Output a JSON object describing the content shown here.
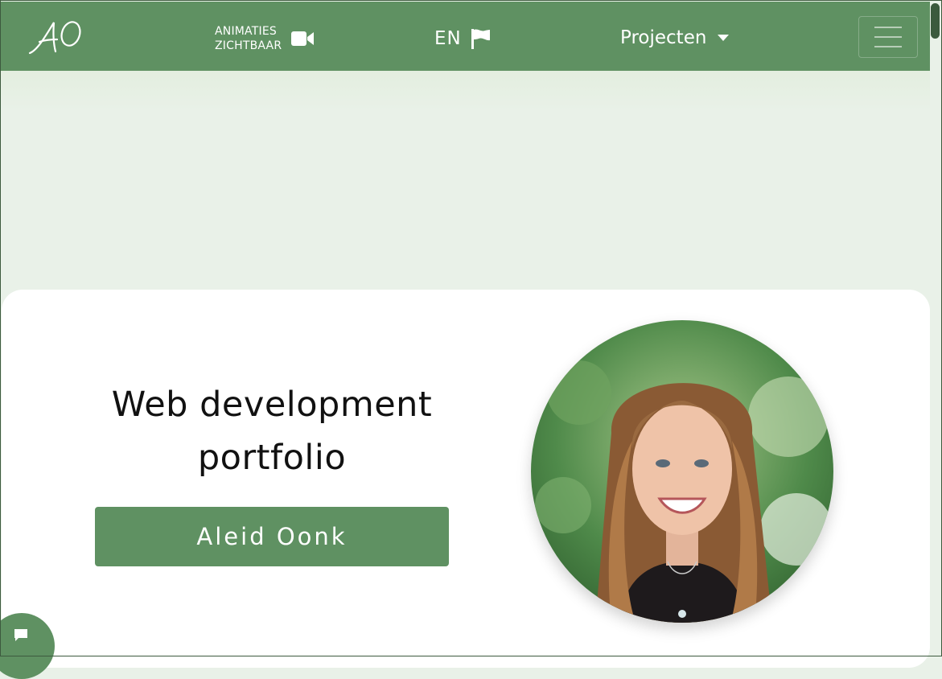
{
  "header": {
    "logo_text": "AO",
    "animations_toggle": {
      "line1": "ANIMATIES",
      "line2": "ZICHTBAAR",
      "icon": "video-camera-icon"
    },
    "language_switch": {
      "label": "EN",
      "icon": "flag-icon"
    },
    "projects_dropdown": {
      "label": "Projecten",
      "icon": "caret-down-icon"
    },
    "menu_toggle": {
      "icon": "hamburger-menu-icon"
    }
  },
  "hero": {
    "title_line1": "Web development",
    "title_line2": "portfolio",
    "name_button": "Aleid Oonk",
    "avatar_description": "portrait-photo"
  },
  "chat_widget": {
    "icon": "chat-bubble-icon"
  },
  "colors": {
    "brand_green": "#5f9162",
    "page_background": "#e9f1e8",
    "card_background": "#ffffff",
    "scrollbar": "#3b5a3d"
  }
}
